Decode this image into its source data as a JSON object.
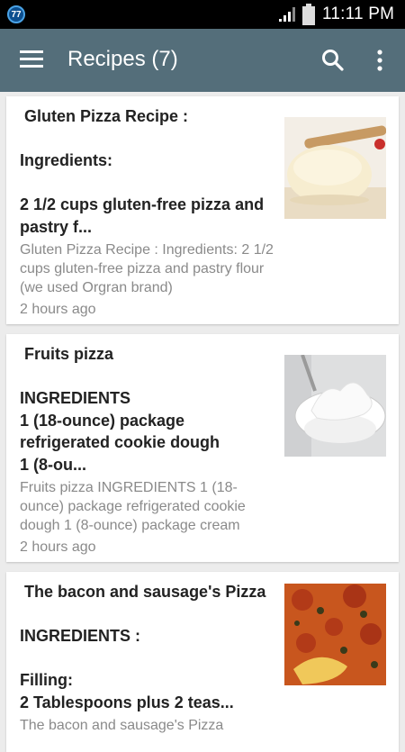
{
  "statusbar": {
    "app_badge": "77",
    "time": "11:11 PM"
  },
  "appbar": {
    "title": "Recipes (7)"
  },
  "icons": {
    "menu": "hamburger-menu-icon",
    "search": "search-icon",
    "overflow": "more-vert-icon"
  },
  "colors": {
    "appbar": "#546e7a",
    "background": "#ececec",
    "title_text": "#222222",
    "secondary_text": "#8a8a8a"
  },
  "recipes": [
    {
      "title": " Gluten Pizza Recipe :\n\nIngredients:\n\n2 1/2 cups gluten-free pizza and pastry f...",
      "snippet": "Gluten Pizza Recipe : Ingredients: 2 1/2 cups gluten-free pizza and pastry flour (we used Orgran brand)",
      "time": "2 hours ago",
      "image": "pizza-dough-image"
    },
    {
      "title": " Fruits pizza\n\nINGREDIENTS\n1 (18-ounce) package refrigerated cookie dough\n1 (8-ou...",
      "snippet": "Fruits pizza INGREDIENTS 1 (18-ounce) package refrigerated cookie dough 1 (8-ounce) package cream",
      "time": "2 hours ago",
      "image": "cream-cheese-bowl-image"
    },
    {
      "title": " The bacon and sausage's Pizza\n\nINGREDIENTS :\n\nFilling:\n2 Tablespoons plus 2 teas...",
      "snippet": "The bacon and sausage's Pizza",
      "time": "",
      "image": "pizza-slice-image"
    }
  ]
}
